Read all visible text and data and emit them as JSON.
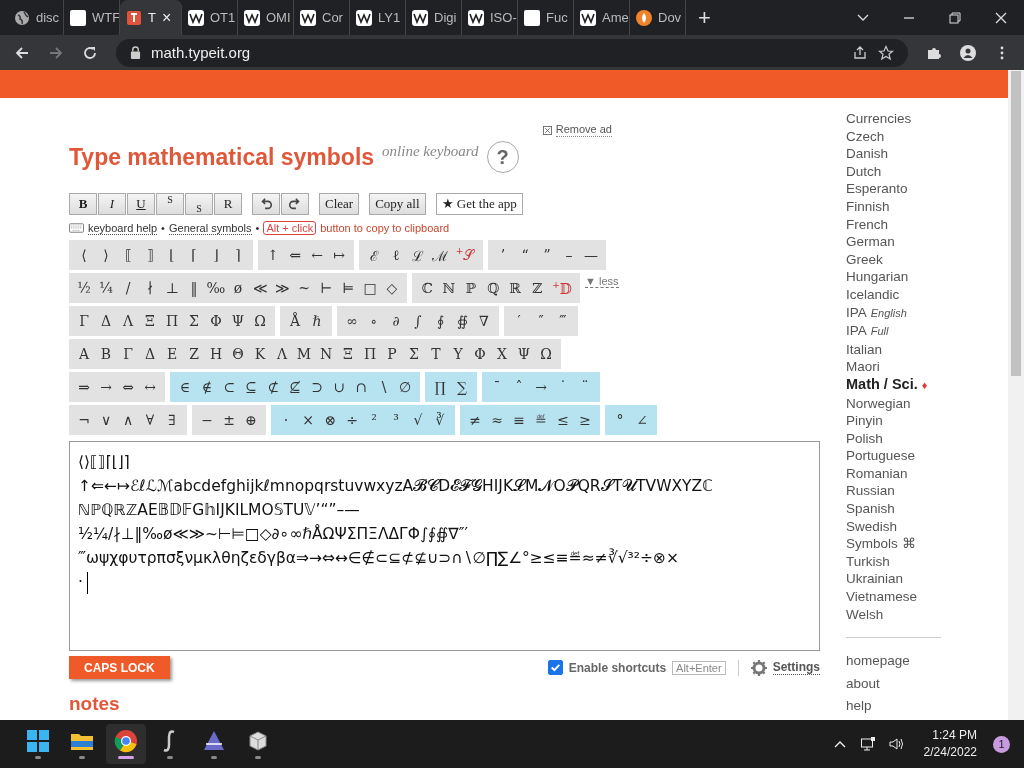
{
  "browser": {
    "tabs": [
      {
        "kind": "globe",
        "label": "disc",
        "selected": false
      },
      {
        "kind": "wtf",
        "label": "WTF",
        "selected": false
      },
      {
        "kind": "t",
        "label": "T",
        "selected": true,
        "close": "×"
      },
      {
        "kind": "w",
        "label": "OT1",
        "selected": false
      },
      {
        "kind": "w",
        "label": "OMI",
        "selected": false
      },
      {
        "kind": "w",
        "label": "Cor",
        "selected": false
      },
      {
        "kind": "w",
        "label": "LY1",
        "selected": false
      },
      {
        "kind": "w",
        "label": "Digi",
        "selected": false
      },
      {
        "kind": "w",
        "label": "ISO-",
        "selected": false
      },
      {
        "kind": "wtf",
        "label": "Fuc",
        "selected": false
      },
      {
        "kind": "w",
        "label": "Ame",
        "selected": false
      },
      {
        "kind": "flame",
        "label": "Dov",
        "selected": false
      }
    ],
    "new_tab": "+",
    "address": "math.typeit.org"
  },
  "remove_ad": "Remove ad",
  "title": "Type mathematical symbols",
  "subtitle": "online keyboard",
  "help_button": "?",
  "format_buttons": [
    {
      "kind": "bold",
      "label": "B"
    },
    {
      "kind": "italic",
      "label": "I"
    },
    {
      "kind": "underline",
      "label": "U"
    },
    {
      "kind": "sup",
      "label": "S"
    },
    {
      "kind": "sub",
      "label": "S"
    },
    {
      "kind": "plain",
      "label": "R"
    }
  ],
  "actions": [
    "Clear",
    "Copy all",
    "★ Get the app"
  ],
  "help_line": {
    "keyboard_help": "keyboard help",
    "sep1": "•",
    "general": "General symbols",
    "sep2": "•",
    "shortcut": "Alt + click",
    "hint": "button to copy to clipboard"
  },
  "symbol_rows": [
    {
      "groups": [
        {
          "highlighted": false,
          "keys": [
            "⟨",
            "⟩",
            "⟦",
            "⟧",
            "⌊",
            "⌈",
            "⌋",
            "⌉"
          ]
        },
        {
          "highlighted": false,
          "keys": [
            "↑",
            "⇐",
            "←",
            "↦"
          ]
        },
        {
          "highlighted": false,
          "keys": [
            "ℰ",
            "ℓ",
            "ℒ",
            "ℳ"
          ],
          "extra": {
            "mark": "+",
            "label": "𝒮"
          }
        },
        {
          "highlighted": false,
          "keys": [
            "’",
            "“",
            "”",
            "–",
            "—"
          ]
        }
      ]
    },
    {
      "groups": [
        {
          "highlighted": false,
          "keys": [
            "½",
            "¼",
            "/",
            "∤",
            "⊥",
            "‖",
            "‰",
            "ø",
            "≪",
            "≫",
            "~",
            "⊢",
            "⊨",
            "□",
            "◇"
          ]
        },
        {
          "highlighted": false,
          "keys": [
            "ℂ",
            "ℕ",
            "ℙ",
            "ℚ",
            "ℝ",
            "ℤ"
          ],
          "extra": {
            "mark": "+",
            "label": "𝔻"
          }
        }
      ],
      "toggle": "▼ less"
    },
    {
      "groups": [
        {
          "highlighted": false,
          "keys": [
            "Γ",
            "Δ",
            "Λ",
            "Ξ",
            "Π",
            "Σ",
            "Φ",
            "Ψ",
            "Ω"
          ]
        },
        {
          "highlighted": false,
          "keys": [
            "Å",
            "ℏ"
          ]
        },
        {
          "highlighted": false,
          "keys": [
            "∞",
            "∘",
            "∂",
            "∫",
            "∮",
            "∯",
            "∇"
          ]
        },
        {
          "highlighted": false,
          "keys": [
            "′",
            "″",
            "‴"
          ]
        }
      ]
    },
    {
      "groups": [
        {
          "highlighted": false,
          "keys": [
            "Α",
            "Β",
            "Γ",
            "Δ",
            "Ε",
            "Ζ",
            "Η",
            "Θ",
            "Κ",
            "Λ",
            "Μ",
            "Ν",
            "Ξ",
            "Π",
            "Ρ",
            "Σ",
            "Τ",
            "Υ",
            "Φ",
            "Χ",
            "Ψ",
            "Ω"
          ]
        }
      ]
    },
    {
      "groups": [
        {
          "highlighted": false,
          "keys": [
            "⇒",
            "→",
            "⇔",
            "↔"
          ]
        },
        {
          "highlighted": true,
          "keys": [
            "∈",
            "∉",
            "⊂",
            "⊆",
            "⊄",
            "⊈",
            "⊃",
            "∪",
            "∩",
            "∖",
            "∅"
          ]
        },
        {
          "highlighted": true,
          "keys": [
            "∏",
            "∑"
          ]
        },
        {
          "highlighted": true,
          "keys": [
            "¯",
            "ˆ",
            "→",
            "˙",
            "¨"
          ]
        }
      ]
    },
    {
      "groups": [
        {
          "highlighted": false,
          "keys": [
            "¬",
            "∨",
            "∧",
            "∀",
            "∃"
          ]
        },
        {
          "highlighted": false,
          "keys": [
            "−",
            "±",
            "⊕"
          ]
        },
        {
          "highlighted": true,
          "keys": [
            "·",
            "×",
            "⊗",
            "÷",
            "²",
            "³",
            "√",
            "∛"
          ]
        },
        {
          "highlighted": true,
          "keys": [
            "≠",
            "≈",
            "≡",
            "≝",
            "≤",
            "≥"
          ]
        },
        {
          "highlighted": true,
          "keys": [
            "°",
            "∠"
          ]
        }
      ]
    }
  ],
  "editor": {
    "lines": [
      "⟨⟩⟦⟧⌈⌊⌋⌉",
      "↑⇐←↦ℰℓℒℳabcdefghijkℓmnopqrstuvwxyzA𝓑𝓒D𝓔𝓕𝓖HIJK𝓛M𝓝O𝓟QR𝓢T𝓤TVWXYZℂ",
      "ℕℙℚℝℤAE𝔹𝔻𝔽G𝕙IJKILMO𝕊TU𝕍’“”–—",
      "½¼/∤⊥‖‰ø≪≫~⊢⊨□◇∂∘∞ℏÅΩΨΣΠΞΛΔΓΦ∫∮∯∇″′",
      "‴ωψχφυτρπσξνμκλθηζεδγβα⇒→⇔↔∈∉⊂⊆⊄⊈∪⊃∩∖∅∏∑∠°≥≤≡≝≈≠∛√³²÷⊗×",
      "·"
    ]
  },
  "caps_lock": "CAPS LOCK",
  "shortcuts": {
    "checked": true,
    "label": "Enable shortcuts",
    "key": "Alt+Enter"
  },
  "settings": "Settings",
  "notes_heading": "notes",
  "sidebar": {
    "items": [
      {
        "label": "Currencies",
        "selected": false
      },
      {
        "label": "Czech",
        "selected": false
      },
      {
        "label": "Danish",
        "selected": false
      },
      {
        "label": "Dutch",
        "selected": false
      },
      {
        "label": "Esperanto",
        "selected": false
      },
      {
        "label": "Finnish",
        "selected": false
      },
      {
        "label": "French",
        "selected": false
      },
      {
        "label": "German",
        "selected": false
      },
      {
        "label": "Greek",
        "selected": false
      },
      {
        "label": "Hungarian",
        "selected": false
      },
      {
        "label": "Icelandic",
        "selected": false
      },
      {
        "label": "IPA",
        "note": "English",
        "selected": false
      },
      {
        "label": "IPA",
        "note": "Full",
        "selected": false
      },
      {
        "label": "Italian",
        "selected": false
      },
      {
        "label": "Maori",
        "selected": false
      },
      {
        "label": "Math / Sci.",
        "selected": true,
        "marker": "♦"
      },
      {
        "label": "Norwegian",
        "selected": false
      },
      {
        "label": "Pinyin",
        "selected": false
      },
      {
        "label": "Polish",
        "selected": false
      },
      {
        "label": "Portuguese",
        "selected": false
      },
      {
        "label": "Romanian",
        "selected": false
      },
      {
        "label": "Russian",
        "selected": false
      },
      {
        "label": "Spanish",
        "selected": false
      },
      {
        "label": "Swedish",
        "selected": false
      },
      {
        "label": "Symbols ⌘",
        "selected": false
      },
      {
        "label": "Turkish",
        "selected": false
      },
      {
        "label": "Ukrainian",
        "selected": false
      },
      {
        "label": "Vietnamese",
        "selected": false
      },
      {
        "label": "Welsh",
        "selected": false
      }
    ],
    "links": [
      "homepage",
      "about",
      "help"
    ]
  },
  "taskbar": {
    "apps": [
      {
        "kind": "start",
        "active": false
      },
      {
        "kind": "folder",
        "active": false
      },
      {
        "kind": "chrome",
        "active": true
      },
      {
        "kind": "script",
        "active": false
      },
      {
        "kind": "triangle",
        "active": false
      },
      {
        "kind": "cube",
        "active": false
      }
    ],
    "time": "1:24 PM",
    "date": "2/24/2022",
    "notifications": "1"
  }
}
